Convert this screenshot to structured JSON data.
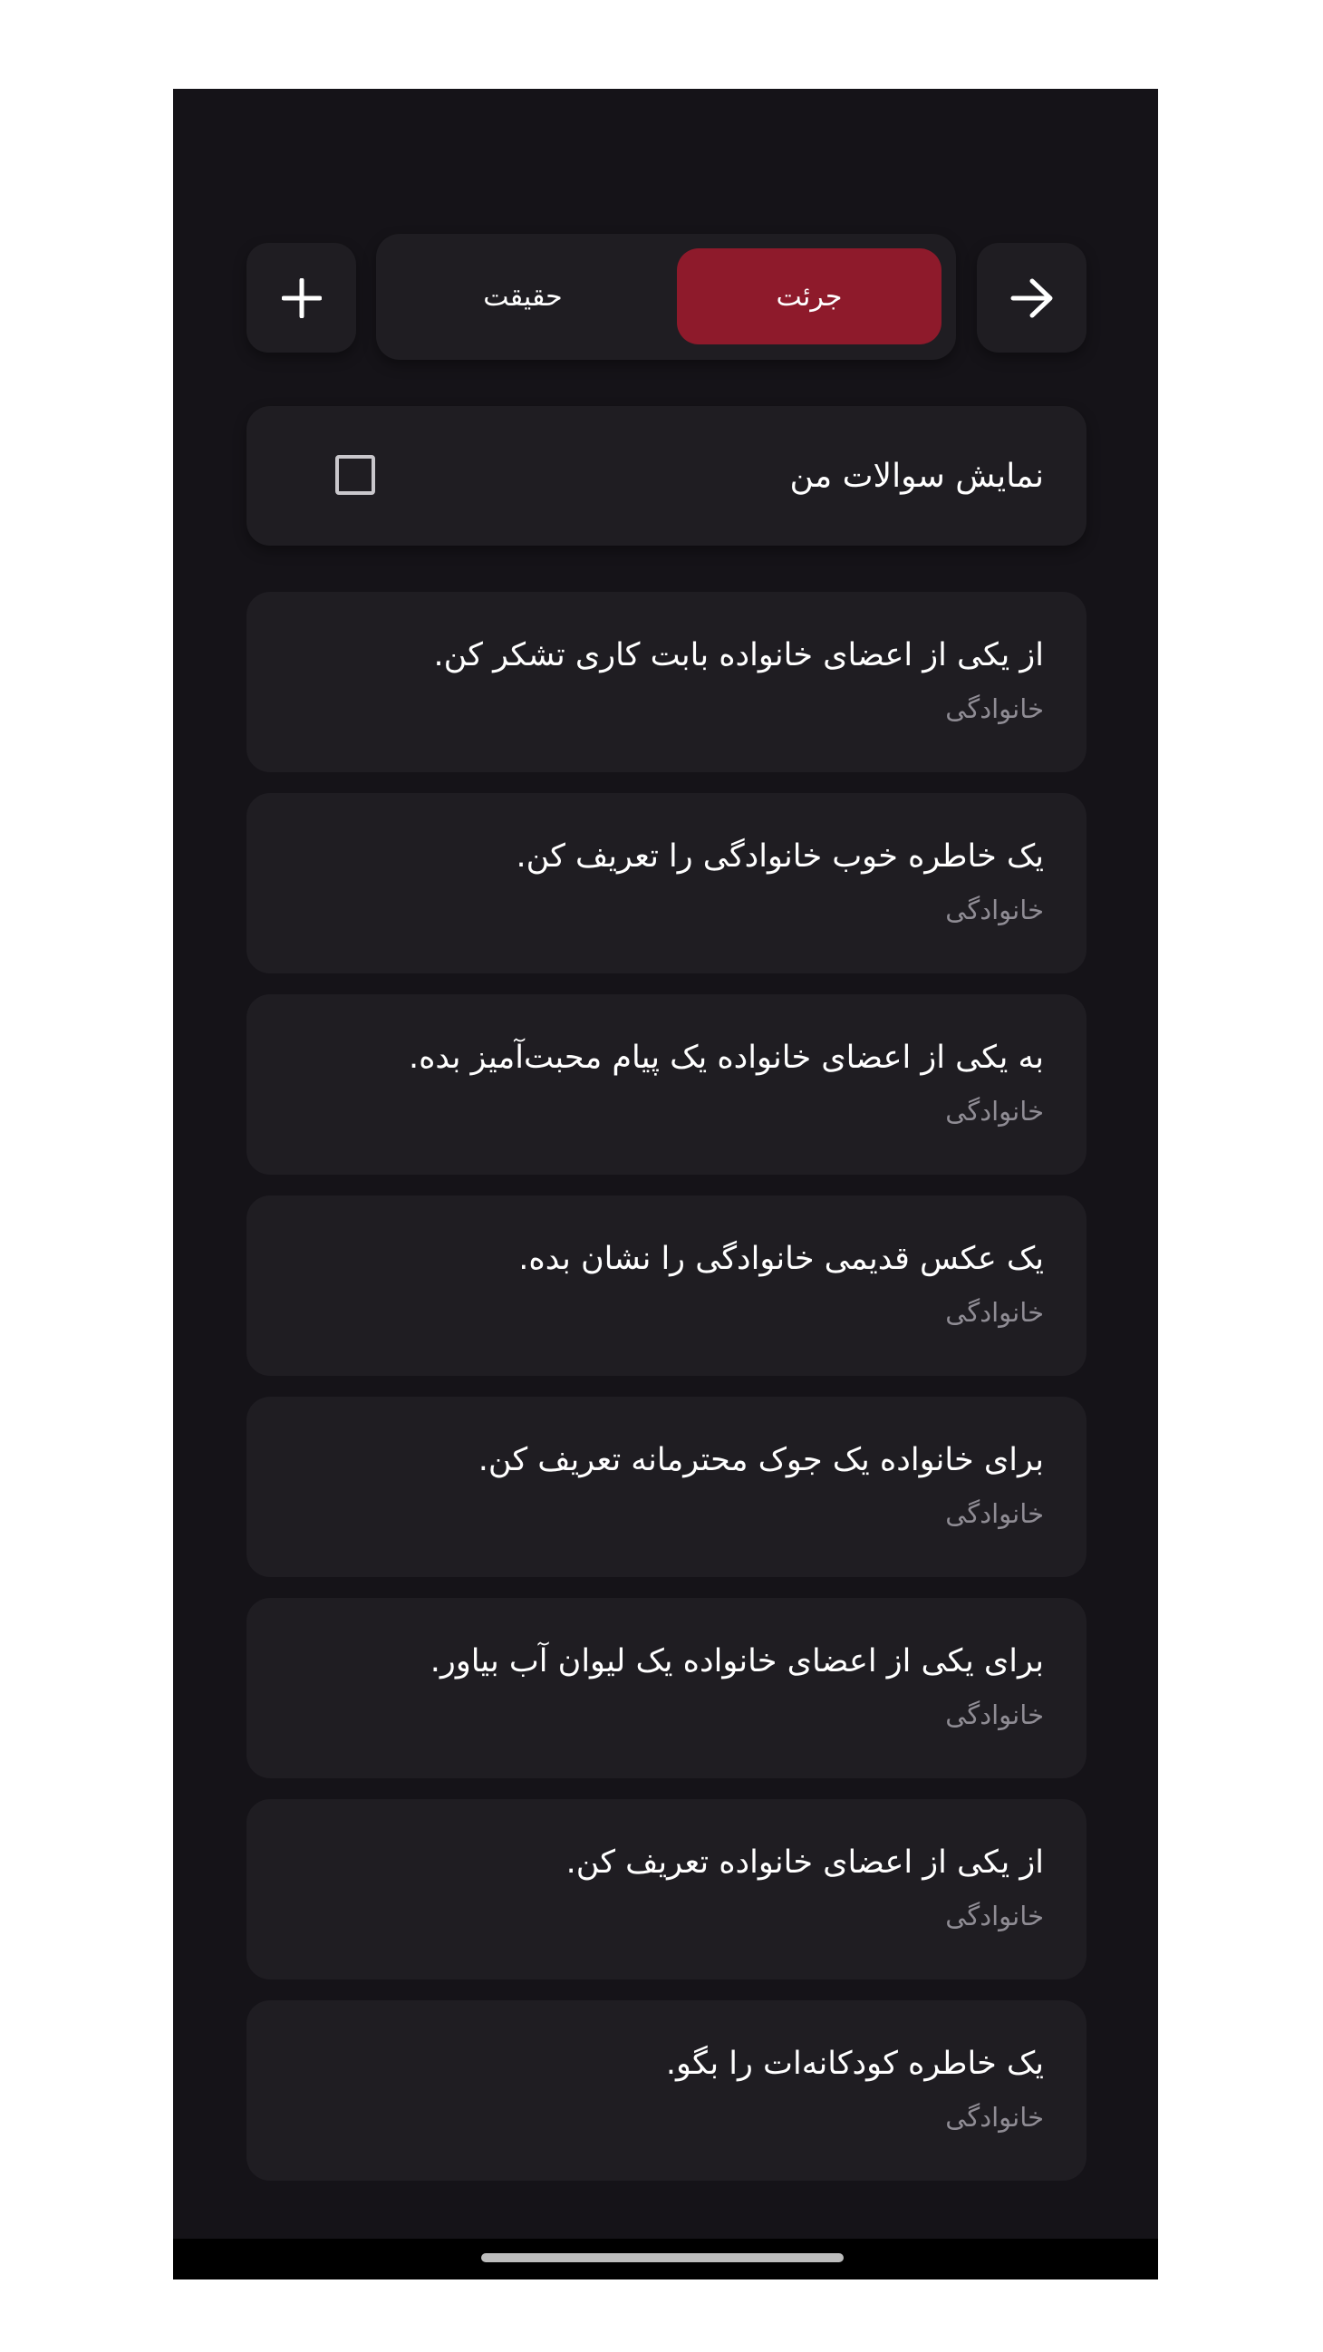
{
  "header": {
    "add_icon": "plus-icon",
    "next_icon": "arrow-right-icon",
    "segment_options": [
      {
        "label": "حقیقت",
        "active": false
      },
      {
        "label": "جرئت",
        "active": true
      }
    ],
    "accent_color": "#8e1a2b"
  },
  "filter": {
    "label": "نمایش سوالات من",
    "checked": false
  },
  "questions": [
    {
      "text": "از یکی از اعضای خانواده بابت کاری تشکر کن.",
      "category": "خانوادگی"
    },
    {
      "text": "یک خاطره خوب خانوادگی را تعریف کن.",
      "category": "خانوادگی"
    },
    {
      "text": "به یکی از اعضای خانواده یک پیام محبت‌آمیز بده.",
      "category": "خانوادگی"
    },
    {
      "text": "یک عکس قدیمی خانوادگی را نشان بده.",
      "category": "خانوادگی"
    },
    {
      "text": "برای خانواده یک جوک محترمانه تعریف کن.",
      "category": "خانوادگی"
    },
    {
      "text": "برای یکی از اعضای خانواده یک لیوان آب بیاور.",
      "category": "خانوادگی"
    },
    {
      "text": "از یکی از اعضای خانواده تعریف کن.",
      "category": "خانوادگی"
    },
    {
      "text": "یک خاطره کودکانه‌ات را بگو.",
      "category": "خانوادگی"
    }
  ],
  "colors": {
    "background": "#151318",
    "card": "#1f1d22",
    "text": "#ffffff",
    "muted": "#8f8c94"
  }
}
